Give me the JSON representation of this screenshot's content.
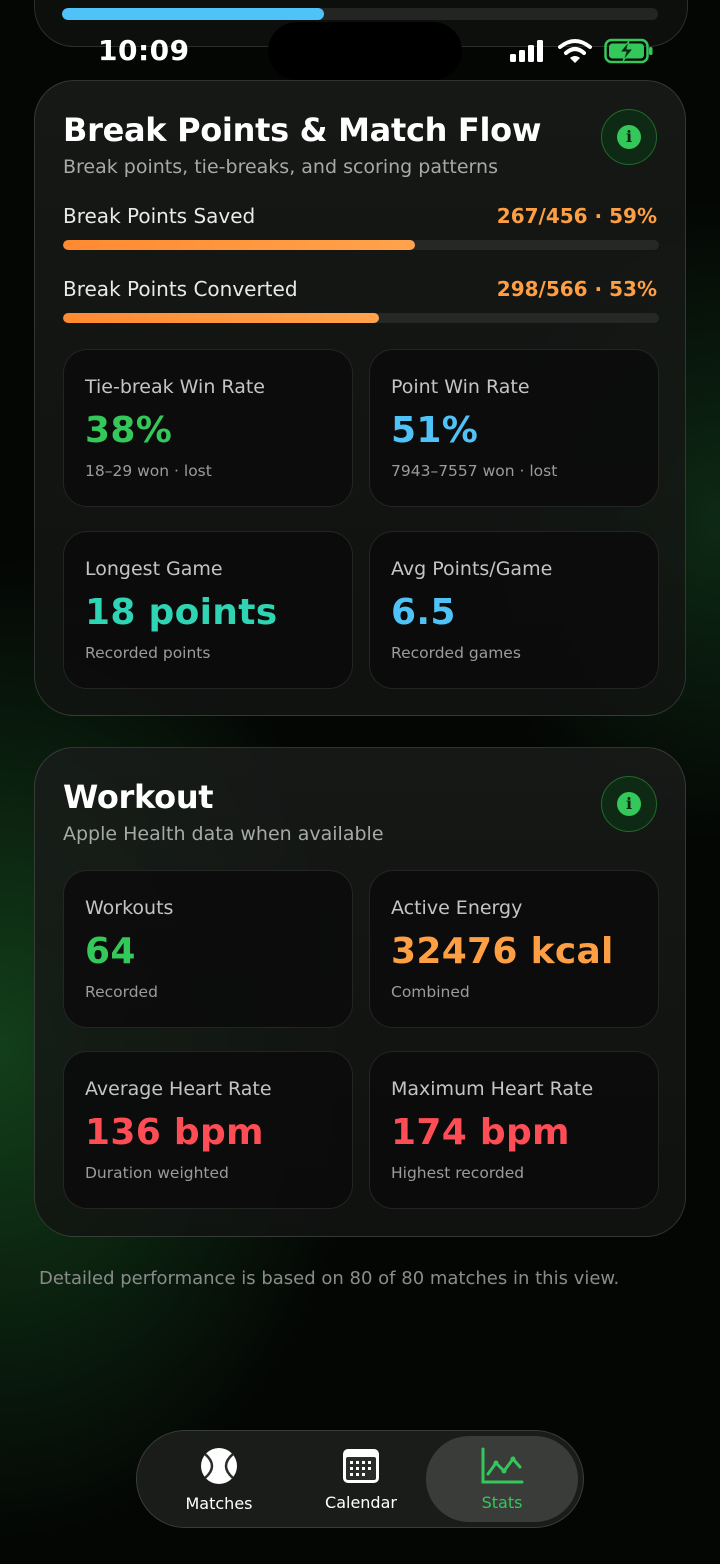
{
  "status_bar": {
    "time": "10:09"
  },
  "top_progress": {
    "fraction": 0.44
  },
  "break_points_card": {
    "title": "Break Points & Match Flow",
    "subtitle": "Break points, tie-breaks, and scoring patterns",
    "bars": [
      {
        "label": "Break Points Saved",
        "value": "267/456 · 59%",
        "fraction": 0.59
      },
      {
        "label": "Break Points Converted",
        "value": "298/566 · 53%",
        "fraction": 0.53
      }
    ],
    "tiles": [
      {
        "label": "Tie-break Win Rate",
        "value": "38%",
        "note": "18–29 won · lost",
        "color": "#34c759"
      },
      {
        "label": "Point Win Rate",
        "value": "51%",
        "note": "7943–7557 won · lost",
        "color": "#4fc3f7"
      },
      {
        "label": "Longest Game",
        "value": "18 points",
        "note": "Recorded points",
        "color": "#2fd4b4"
      },
      {
        "label": "Avg Points/Game",
        "value": "6.5",
        "note": "Recorded games",
        "color": "#4fc3f7"
      }
    ]
  },
  "workout_card": {
    "title": "Workout",
    "subtitle": "Apple Health data when available",
    "tiles": [
      {
        "label": "Workouts",
        "value": "64",
        "note": "Recorded",
        "color": "#34c759"
      },
      {
        "label": "Active Energy",
        "value": "32476 kcal",
        "note": "Combined",
        "color": "#ff9f43"
      },
      {
        "label": "Average Heart Rate",
        "value": "136 bpm",
        "note": "Duration weighted",
        "color": "#ff4d55"
      },
      {
        "label": "Maximum Heart Rate",
        "value": "174 bpm",
        "note": "Highest recorded",
        "color": "#ff4d55"
      }
    ]
  },
  "footer_note": "Detailed performance is based on 80 of 80 matches in this view.",
  "tab_bar": {
    "tabs": [
      {
        "label": "Matches",
        "icon": "tennis-ball-icon"
      },
      {
        "label": "Calendar",
        "icon": "calendar-icon"
      },
      {
        "label": "Stats",
        "icon": "line-chart-icon",
        "active": true
      }
    ],
    "active_color": "#34c759"
  }
}
